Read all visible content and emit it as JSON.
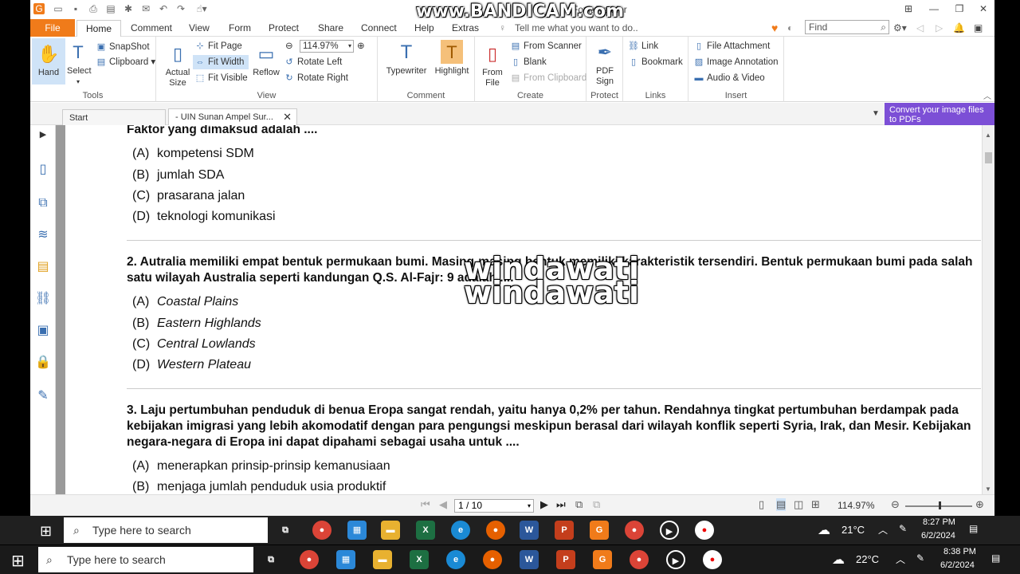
{
  "app": {
    "title": "Foxit Reader",
    "watermark_top": "www.BANDICAM.com",
    "menu": {
      "file": "File",
      "tabs": [
        "Home",
        "Comment",
        "View",
        "Form",
        "Protect",
        "Share",
        "Connect",
        "Help",
        "Extras"
      ],
      "tellme": "Tell me what you want to do..",
      "find_placeholder": "Find"
    },
    "ribbon": {
      "tools": {
        "hand": "Hand",
        "select": "Select",
        "snapshot": "SnapShot",
        "clipboard": "Clipboard",
        "label": "Tools"
      },
      "view": {
        "actual_size": "Actual Size",
        "fit_page": "Fit Page",
        "fit_width": "Fit Width",
        "fit_visible": "Fit Visible",
        "reflow": "Reflow",
        "zoom": "114.97%",
        "rotate_left": "Rotate Left",
        "rotate_right": "Rotate Right",
        "label": "View"
      },
      "comment": {
        "typewriter": "Typewriter",
        "highlight": "Highlight",
        "label": "Comment"
      },
      "create": {
        "from_file": "From File",
        "from_scanner": "From Scanner",
        "blank": "Blank",
        "from_clipboard": "From Clipboard",
        "label": "Create"
      },
      "protect": {
        "pdf_sign": "PDF Sign",
        "label": "Protect"
      },
      "links": {
        "link": "Link",
        "bookmark": "Bookmark",
        "label": "Links"
      },
      "insert": {
        "file_attachment": "File Attachment",
        "image_annotation": "Image Annotation",
        "audio_video": "Audio & Video",
        "label": "Insert"
      }
    },
    "tabs": {
      "start": "Start",
      "doc": "- UIN Sunan Ampel Sur...",
      "convert": "Convert your image files to PDFs"
    },
    "document": {
      "q1_tail": "Faktor yang dimaksud adalah ....",
      "q1_options": [
        {
          "label": "(A)",
          "text": "kompetensi SDM"
        },
        {
          "label": "(B)",
          "text": "jumlah SDA"
        },
        {
          "label": "(C)",
          "text": "prasarana jalan"
        },
        {
          "label": "(D)",
          "text": "teknologi komunikasi"
        }
      ],
      "q2_line1": "2. Autralia memiliki empat bentuk permukaan bumi. Masing-masing bentuk memiliki karakteristik tersendiri. Bentuk permukaan bumi pada salah",
      "q2_line2": "satu wilayah Australia seperti kandungan Q.S. Al-Fajr: 9 adalah ....",
      "q2_options": [
        {
          "label": "(A)",
          "text": "Coastal Plains"
        },
        {
          "label": "(B)",
          "text": "Eastern Highlands"
        },
        {
          "label": "(C)",
          "text": "Central Lowlands"
        },
        {
          "label": "(D)",
          "text": "Western Plateau"
        }
      ],
      "q3_line1": "3. Laju pertumbuhan penduduk di benua Eropa sangat rendah, yaitu hanya 0,2% per tahun. Rendahnya tingkat pertumbuhan berdampak pada",
      "q3_line2": "kebijakan imigrasi yang lebih akomodatif dengan para pengungsi meskipun berasal dari wilayah konflik seperti Syria, Irak, dan Mesir. Kebijakan",
      "q3_line3": "negara-negara di Eropa ini dapat dipahami sebagai usaha untuk ....",
      "q3_options": [
        {
          "label": "(A)",
          "text": "menerapkan prinsip-prinsip kemanusiaan"
        },
        {
          "label": "(B)",
          "text": "menjaga jumlah penduduk usia produktif"
        }
      ],
      "overlay_text": "windawati"
    },
    "status": {
      "page": "1 / 10",
      "zoom": "114.97%"
    }
  },
  "taskbar_inner": {
    "search": "Type here to search",
    "temp": "21°C",
    "time": "8:27 PM",
    "date": "6/2/2024"
  },
  "taskbar_outer": {
    "search": "Type here to search",
    "temp": "22°C",
    "time": "8:38 PM",
    "date": "6/2/2024"
  }
}
